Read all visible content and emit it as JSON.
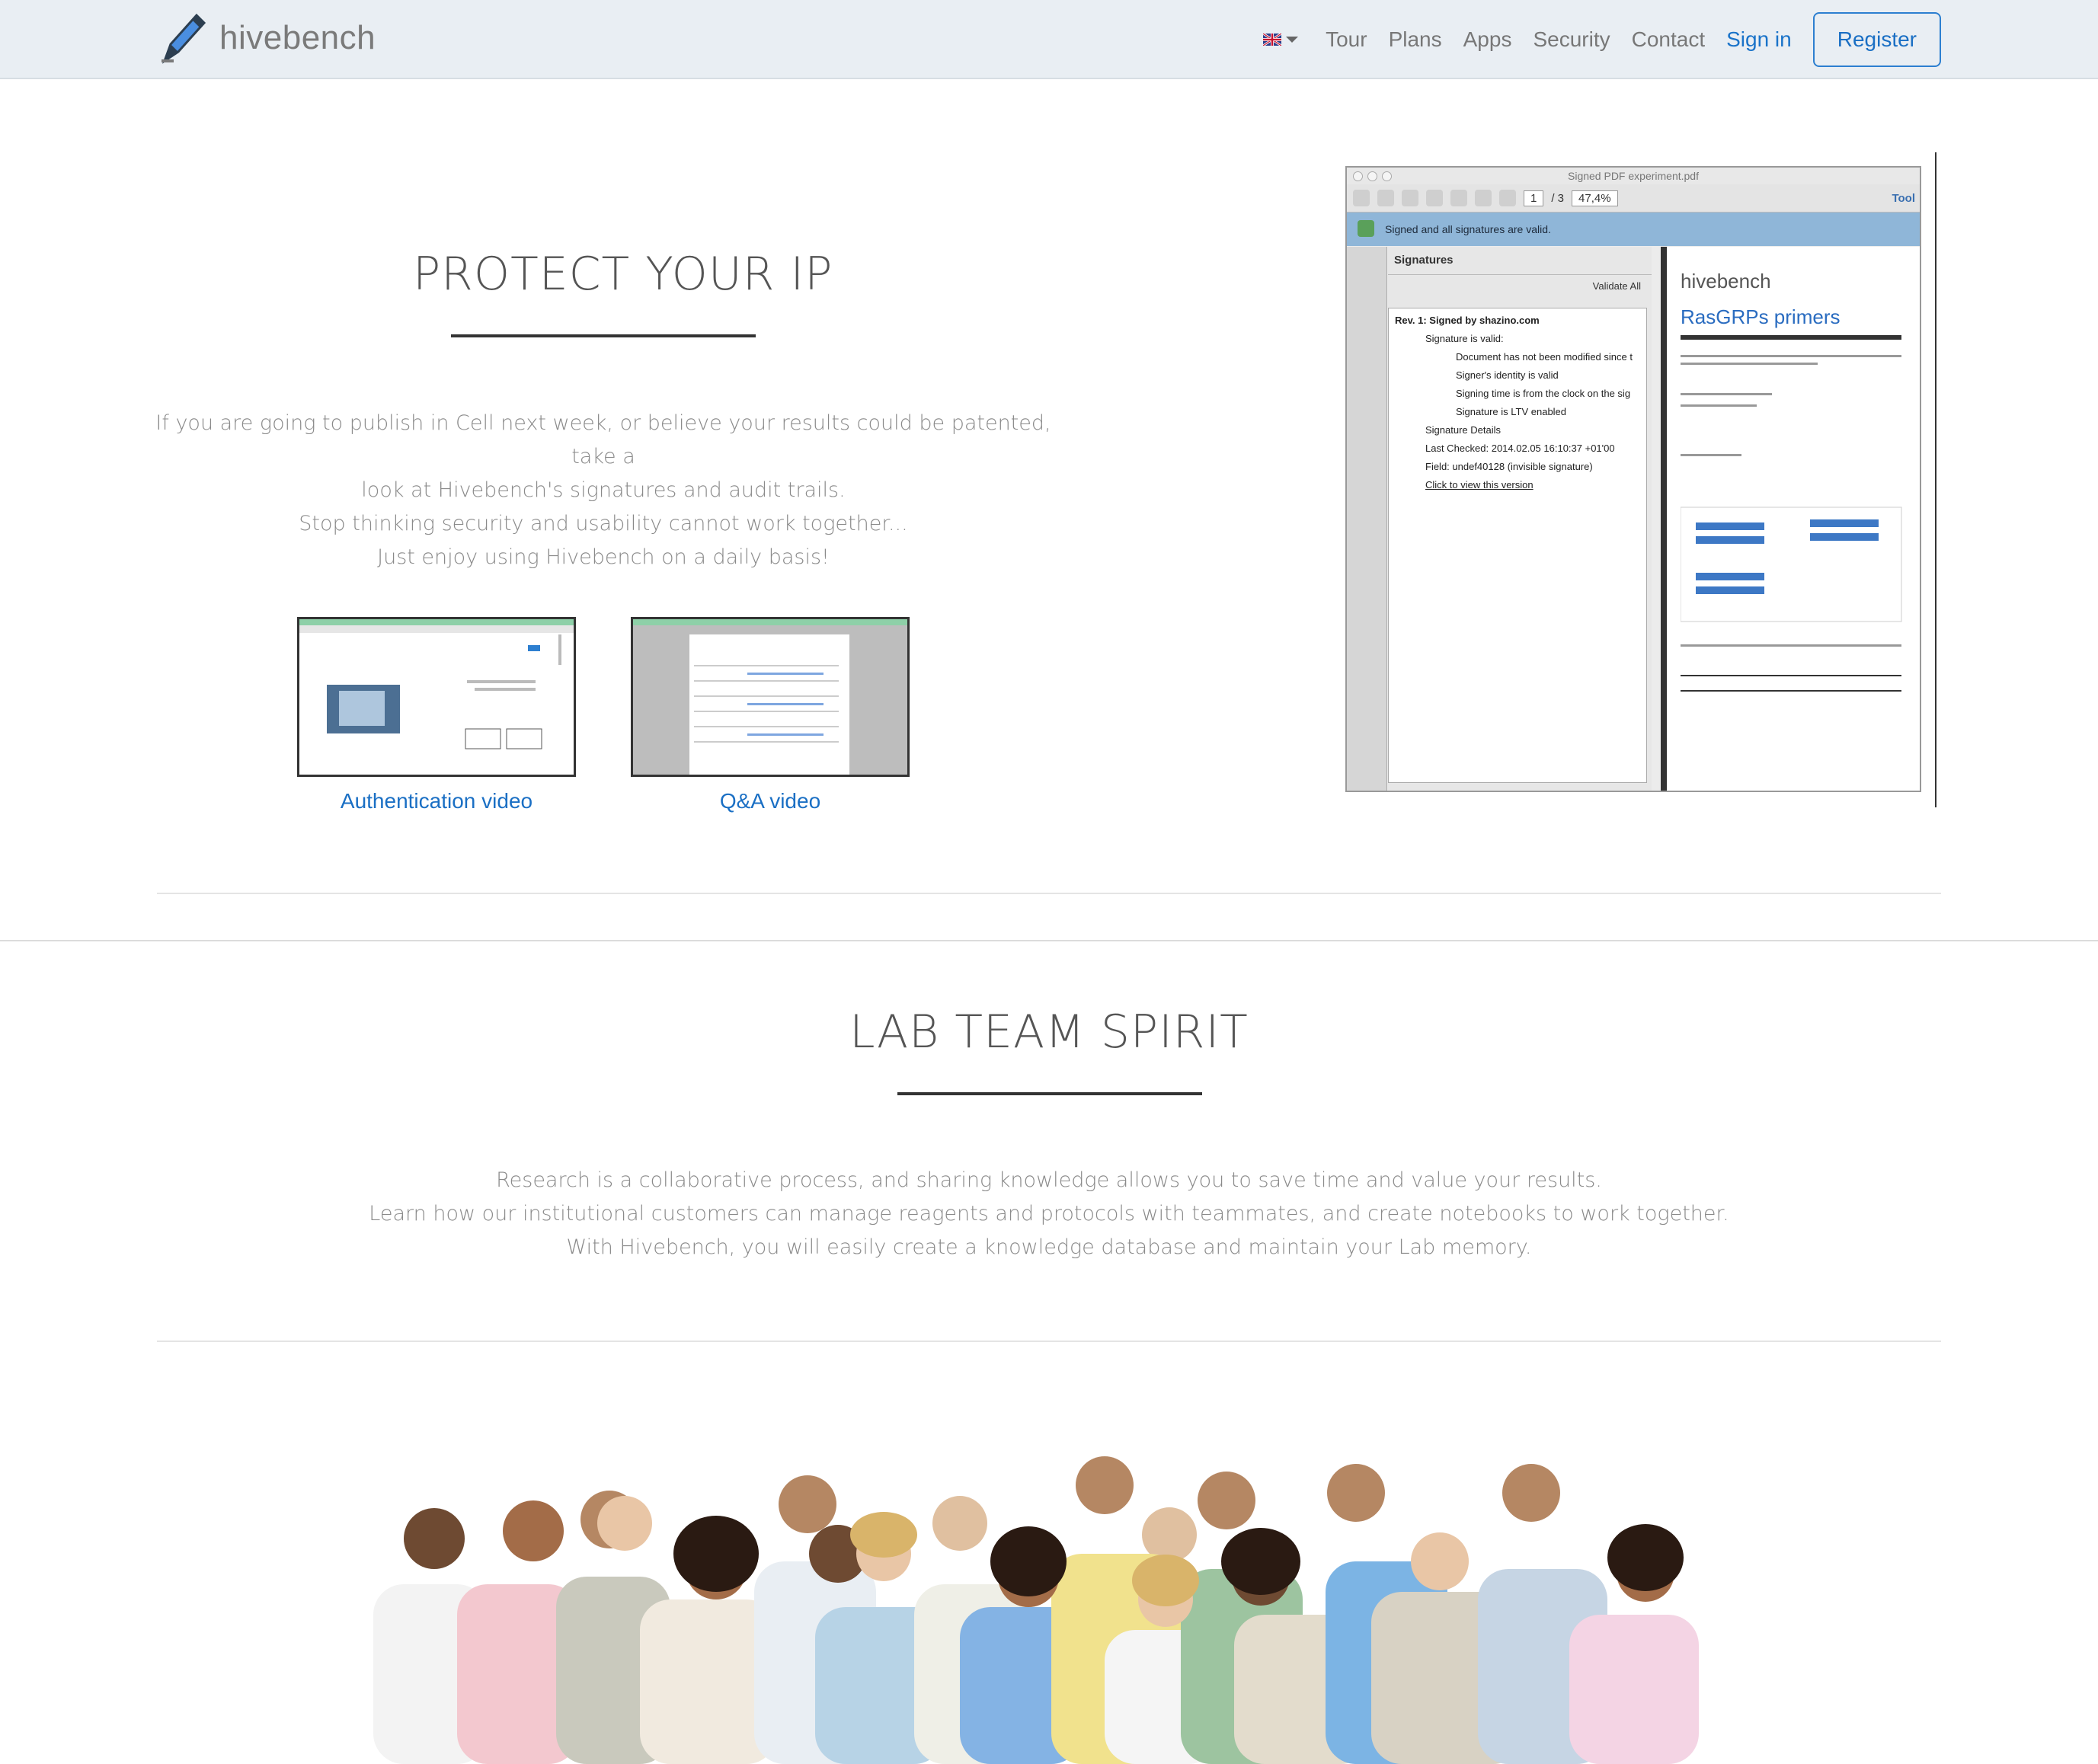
{
  "brand": {
    "name": "hivebench"
  },
  "nav": {
    "language_flag": "uk-flag-icon",
    "items": [
      "Tour",
      "Plans",
      "Apps",
      "Security",
      "Contact"
    ],
    "signin": "Sign in",
    "register": "Register"
  },
  "protect": {
    "title": "PROTECT YOUR IP",
    "lines": [
      "If you are going to publish in Cell next week, or believe your results could be patented, take a",
      "look at Hivebench's signatures and audit trails.",
      "Stop thinking security and usability cannot work together...",
      "Just enjoy using Hivebench on a daily basis!"
    ],
    "videos": [
      {
        "label": "Authentication video"
      },
      {
        "label": "Q&A video"
      }
    ],
    "pdf": {
      "window_title": "Signed PDF experiment.pdf",
      "page": "1",
      "page_total": "/ 3",
      "zoom": "47,4%",
      "tools": "Tool",
      "banner": "Signed and all signatures are valid.",
      "panel_title": "Signatures",
      "validate_all": "Validate All",
      "sig_items": [
        "Rev. 1: Signed by shazino.com",
        "Signature is valid:",
        "Document has not been modified since t",
        "Signer's identity is valid",
        "Signing time is from the clock on the sig",
        "Signature is LTV enabled",
        "Signature Details",
        "Last Checked: 2014.02.05 16:10:37 +01'00",
        "Field: undef40128 (invisible signature)",
        "Click to view this version"
      ],
      "doc_brand": "hivebench",
      "doc_title": "RasGRPs primers"
    }
  },
  "team": {
    "title": "LAB TEAM SPIRIT",
    "lines": [
      "Research is a collaborative process, and sharing knowledge allows you to save time and value your results.",
      "Learn how our institutional customers can manage reagents and protocols with teammates, and create notebooks to work together.",
      "With Hivebench, you will easily create a knowledge database and maintain your Lab memory."
    ]
  }
}
